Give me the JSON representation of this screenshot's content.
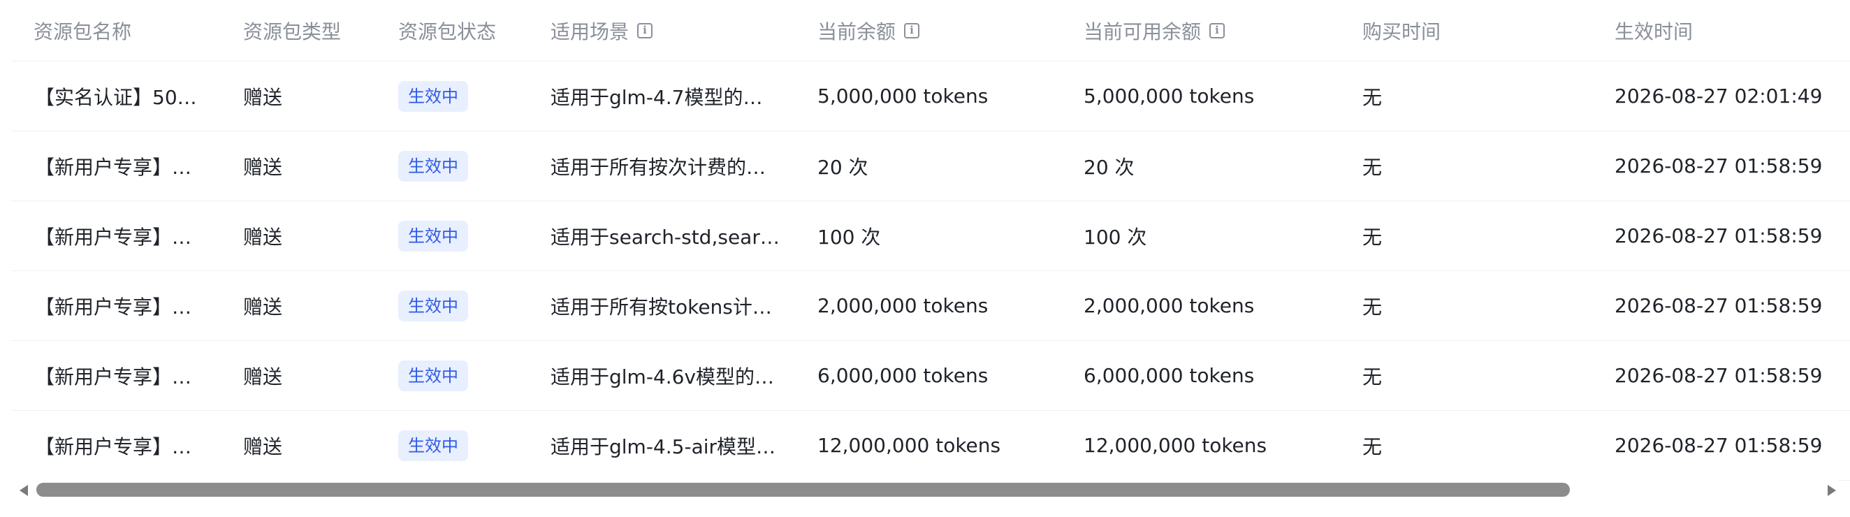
{
  "table": {
    "columns": [
      {
        "label": "资源包名称",
        "info": false
      },
      {
        "label": "资源包类型",
        "info": false
      },
      {
        "label": "资源包状态",
        "info": false
      },
      {
        "label": "适用场景",
        "info": true
      },
      {
        "label": "当前余额",
        "info": true
      },
      {
        "label": "当前可用余额",
        "info": true
      },
      {
        "label": "购买时间",
        "info": false
      },
      {
        "label": "生效时间",
        "info": false
      }
    ],
    "rows": [
      {
        "name": "【实名认证】50…",
        "type": "赠送",
        "status": "生效中",
        "scene": "适用于glm-4.7模型的…",
        "balance": "5,000,000 tokens",
        "available": "5,000,000 tokens",
        "purchase_time": "无",
        "effective_time": "2026-08-27 02:01:49"
      },
      {
        "name": "【新用户专享】…",
        "type": "赠送",
        "status": "生效中",
        "scene": "适用于所有按次计费的…",
        "balance": "20 次",
        "available": "20 次",
        "purchase_time": "无",
        "effective_time": "2026-08-27 01:58:59"
      },
      {
        "name": "【新用户专享】…",
        "type": "赠送",
        "status": "生效中",
        "scene": "适用于search-std,sear…",
        "balance": "100 次",
        "available": "100 次",
        "purchase_time": "无",
        "effective_time": "2026-08-27 01:58:59"
      },
      {
        "name": "【新用户专享】…",
        "type": "赠送",
        "status": "生效中",
        "scene": "适用于所有按tokens计…",
        "balance": "2,000,000 tokens",
        "available": "2,000,000 tokens",
        "purchase_time": "无",
        "effective_time": "2026-08-27 01:58:59"
      },
      {
        "name": "【新用户专享】…",
        "type": "赠送",
        "status": "生效中",
        "scene": "适用于glm-4.6v模型的…",
        "balance": "6,000,000 tokens",
        "available": "6,000,000 tokens",
        "purchase_time": "无",
        "effective_time": "2026-08-27 01:58:59"
      },
      {
        "name": "【新用户专享】…",
        "type": "赠送",
        "status": "生效中",
        "scene": "适用于glm-4.5-air模型…",
        "balance": "12,000,000 tokens",
        "available": "12,000,000 tokens",
        "purchase_time": "无",
        "effective_time": "2026-08-27 01:58:59"
      }
    ]
  },
  "scrollbar": {
    "horizontal_position": 0,
    "visible_fraction": 0.86
  },
  "icons": {
    "info": "info-icon",
    "scroll_left": "arrow-left-icon",
    "scroll_right": "arrow-right-icon"
  },
  "colors": {
    "header_text": "#8a8f99",
    "body_text": "#1f2329",
    "status_badge_bg": "#e8efff",
    "status_badge_text": "#2f5be5",
    "divider": "#eef0f3",
    "scroll_thumb": "#8c8c8c"
  }
}
